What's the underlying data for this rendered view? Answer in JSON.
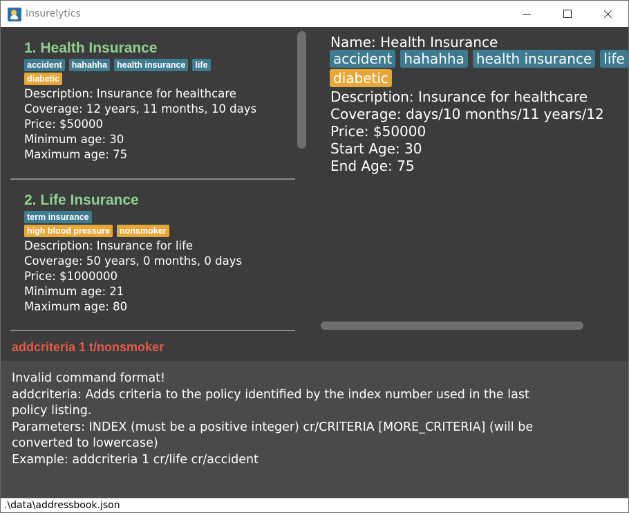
{
  "window": {
    "title": "Insurelytics",
    "controls": {
      "minimize": "minimize",
      "maximize": "maximize",
      "close": "close"
    }
  },
  "policy_list": [
    {
      "index_title": "1.  Health Insurance",
      "tag_rows": [
        [
          {
            "label": "accident",
            "color": "blue"
          },
          {
            "label": "hahahha",
            "color": "blue"
          },
          {
            "label": "health insurance",
            "color": "blue"
          },
          {
            "label": "life",
            "color": "blue"
          }
        ],
        [
          {
            "label": "diabetic",
            "color": "orange"
          }
        ]
      ],
      "fields": [
        "Description: Insurance for healthcare",
        "Coverage: 12 years, 11 months, 10 days",
        "Price: $50000",
        "Minimum age: 30",
        "Maximum age: 75"
      ]
    },
    {
      "index_title": "2.  Life Insurance",
      "tag_rows": [
        [
          {
            "label": "term insurance",
            "color": "blue"
          }
        ],
        [
          {
            "label": "high blood pressure",
            "color": "orange"
          },
          {
            "label": "nonsmoker",
            "color": "orange"
          }
        ]
      ],
      "fields": [
        "Description: Insurance for life",
        "Coverage: 50 years, 0 months, 0 days",
        "Price: $1000000",
        "Minimum age: 21",
        "Maximum age: 80"
      ]
    }
  ],
  "detail": {
    "name": "Name: Health Insurance",
    "tags": [
      "accident",
      "hahahha",
      "health insurance",
      "life"
    ],
    "criteria": [
      "diabetic"
    ],
    "description": "Description: Insurance for healthcare",
    "coverage": "Coverage: days/10 months/11 years/12",
    "price": "Price: $50000",
    "start_age": "Start Age: 30",
    "end_age": "End Age: 75"
  },
  "command_box": {
    "value": "addcriteria 1 t/nonsmoker"
  },
  "result": {
    "lines": [
      "Invalid command format!",
      "addcriteria: Adds criteria to the policy identified by the index number used in the last",
      "policy listing.",
      "Parameters: INDEX (must be a positive integer) cr/CRITERIA [MORE_CRITERIA] (will be",
      "converted to lowercase)",
      "Example: addcriteria 1 cr/life cr/accident"
    ]
  },
  "status_bar": {
    "path": ".\\data\\addressbook.json"
  },
  "colors": {
    "background": "#3c3c3c",
    "result_background": "#4a4a4a",
    "card_title": "#8ed18c",
    "tag_blue": "#3e7b91",
    "tag_orange": "#e6a739",
    "command_text": "#e05c48"
  }
}
